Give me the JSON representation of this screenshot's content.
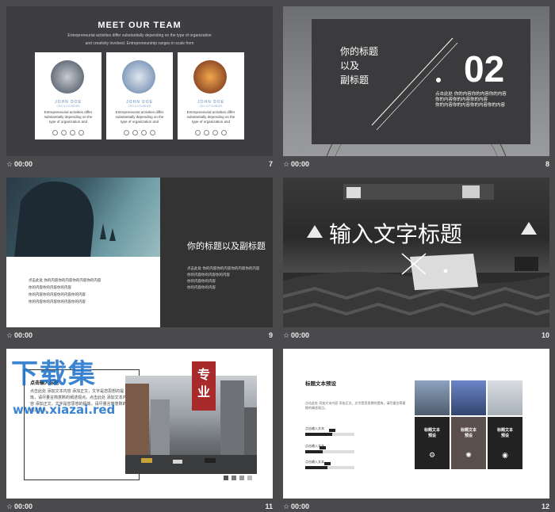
{
  "thumbnails": [
    {
      "time": "00:00",
      "number": "7"
    },
    {
      "time": "00:00",
      "number": "8"
    },
    {
      "time": "00:00",
      "number": "9"
    },
    {
      "time": "00:00",
      "number": "10"
    },
    {
      "time": "00:00",
      "number": "11"
    },
    {
      "time": "00:00",
      "number": "12"
    }
  ],
  "slide7": {
    "title": "MEET OUR TEAM",
    "subtitle_1": "Entrepreneurial activities differ substantially depending on the type of organization",
    "subtitle_2": "and creativity involved. Entrepreneurship ranges in scale from",
    "cards": [
      {
        "name": "JOHN DOE",
        "role": "CEO & FOUNDER",
        "text": "Entrepreneurial activities differ substantially depending on the type of organization and"
      },
      {
        "name": "JOHN DOE",
        "role": "CEO & FOUNDER",
        "text": "Entrepreneurial activities differ substantially depending on the type of organization and"
      },
      {
        "name": "JOHN DOE",
        "role": "CEO & FOUNDER",
        "text": "Entrepreneurial activities differ substantially depending on the type of organization and"
      }
    ]
  },
  "slide8": {
    "heading_1": "你的标题",
    "heading_2": "以及",
    "heading_3": "副标题",
    "number": "02",
    "body_1": "点击此处 你的内容你的内容你的内容",
    "body_2": "你的内容你的内容你的内容",
    "body_3": "你的内容你的内容你的内容你的内容"
  },
  "slide9": {
    "heading": "你的标题以及副标题",
    "left_lines": [
      "点击此处 你的内容你的内容你的内容你的内容",
      "你的内容你的内容你的内容",
      "你的内容你的内容你的内容你的内容",
      "你的内容你的内容你的内容你的内容"
    ],
    "right_lines": [
      "点击此处 你的内容你的内容你的内容你的内容",
      "你的内容你的内容你的内容",
      "你的内容你的内容",
      "你的内容你的内容"
    ]
  },
  "slide10": {
    "heading": "输入文字标题"
  },
  "slide11": {
    "heading": "点击输入标题",
    "body": "点击此处 添加文本内容 添加正文，文字是您思想的提炼，请尽量言简意赅的阐述观点。点击此处 添加文本内容 添加正文，文字是您思想的提炼，请尽量言简意赅的阐述观点。",
    "stamp": "专业",
    "watermark": "下载集",
    "watermark_url": "www.xiazai.red",
    "square_colors": [
      "#555555",
      "#777777",
      "#999999",
      "#bbbbbb"
    ]
  },
  "slide12": {
    "heading": "标题文本预设",
    "body": "点击此处 添加文本内容 添加正文，文字是您思想的提炼，请尽量言简意赅的阐述观点。",
    "bars": [
      {
        "label": "点击输入文本",
        "value": 0.55
      },
      {
        "label": "点击输入文本",
        "value": 0.35
      },
      {
        "label": "点击输入文本",
        "value": 0.45
      }
    ],
    "tiles": [
      {
        "label_1": "标题文本",
        "label_2": "预设",
        "color": "#222222",
        "icon": "gear-icon"
      },
      {
        "label_1": "标题文本",
        "label_2": "预设",
        "color": "#5a4f4c",
        "icon": "aperture-icon"
      },
      {
        "label_1": "标题文本",
        "label_2": "预设",
        "color": "#222222",
        "icon": "camera-icon"
      }
    ]
  }
}
